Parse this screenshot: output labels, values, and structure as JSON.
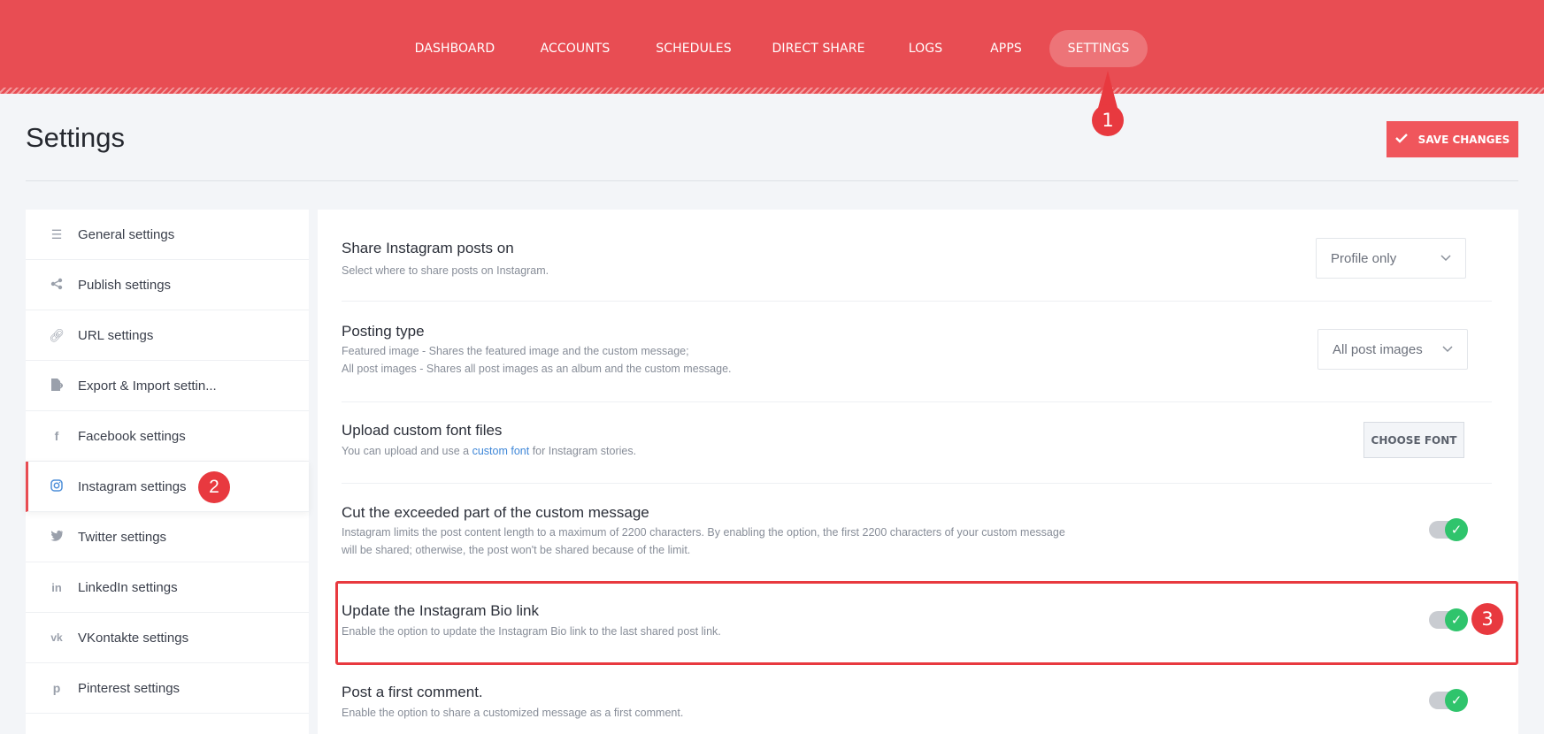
{
  "nav": {
    "items": [
      {
        "label": "DASHBOARD"
      },
      {
        "label": "ACCOUNTS"
      },
      {
        "label": "SCHEDULES"
      },
      {
        "label": "DIRECT SHARE"
      },
      {
        "label": "LOGS"
      },
      {
        "label": "APPS"
      },
      {
        "label": "SETTINGS",
        "active": true
      }
    ]
  },
  "markers": [
    "1",
    "2",
    "3"
  ],
  "header": {
    "title": "Settings",
    "save_label": "SAVE CHANGES",
    "save_icon": "check-icon"
  },
  "sidebar": {
    "items": [
      {
        "label": "General settings",
        "icon": "sliders-icon"
      },
      {
        "label": "Publish settings",
        "icon": "share-icon"
      },
      {
        "label": "URL settings",
        "icon": "link-icon"
      },
      {
        "label": "Export & Import settin...",
        "icon": "file-export-icon"
      },
      {
        "label": "Facebook settings",
        "icon": "facebook-icon"
      },
      {
        "label": "Instagram settings",
        "icon": "instagram-icon",
        "active": true
      },
      {
        "label": "Twitter settings",
        "icon": "twitter-icon"
      },
      {
        "label": "LinkedIn settings",
        "icon": "linkedin-icon"
      },
      {
        "label": "VKontakte settings",
        "icon": "vk-icon"
      },
      {
        "label": "Pinterest settings",
        "icon": "pinterest-icon"
      }
    ]
  },
  "settings": {
    "share_on": {
      "title": "Share Instagram posts on",
      "desc": "Select where to share posts on Instagram.",
      "value": "Profile only"
    },
    "posting_type": {
      "title": "Posting type",
      "desc1": "Featured image - Shares the featured image and the custom message;",
      "desc2": "All post images - Shares all post images as an album and the custom message.",
      "value": "All post images"
    },
    "custom_font": {
      "title": "Upload custom font files",
      "desc_pre": "You can upload and use a ",
      "desc_link": "custom font",
      "desc_post": " for Instagram stories.",
      "button": "CHOOSE FONT"
    },
    "cut_message": {
      "title": "Cut the exceeded part of the custom message",
      "desc1": "Instagram limits the post content length to a maximum of 2200 characters. By enabling the option, the first 2200 characters of your custom message",
      "desc2": "will be shared; otherwise, the post won't be shared because of the limit.",
      "enabled": true
    },
    "bio_link": {
      "title": "Update the Instagram Bio link",
      "desc": "Enable the option to update the Instagram Bio link to the last shared post link.",
      "enabled": true
    },
    "first_comment": {
      "title": "Post a first comment.",
      "desc": "Enable the option to share a customized message as a first comment.",
      "enabled": true
    }
  },
  "colors": {
    "brand": "#e84d53",
    "marker": "#e8393f",
    "toggle_on": "#2fc46c",
    "link": "#3f87d8"
  }
}
